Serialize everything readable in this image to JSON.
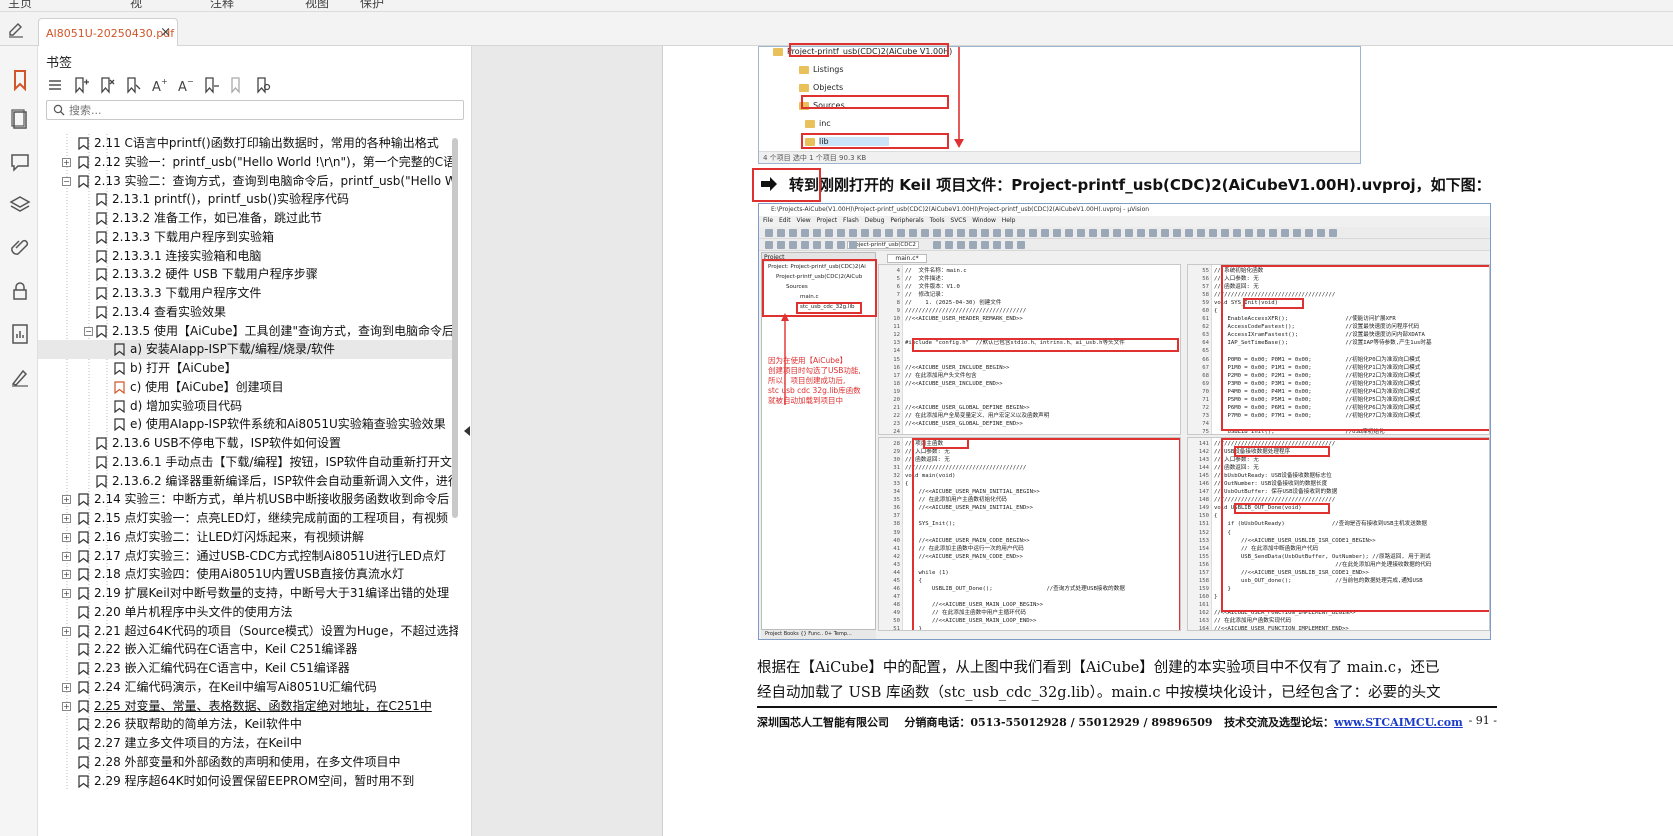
{
  "tab": {
    "title": "AI8051U-20250430.pdf",
    "close": "×"
  },
  "sidebar": {
    "title": "书签",
    "search_placeholder": "搜索...",
    "items": [
      {
        "label": "2.11  C语言中printf()函数打印输出数据时，常用的各种输出格式",
        "level": 1,
        "exp": ""
      },
      {
        "label": "2.12  实验一：printf_usb(\"Hello World !\\r\\n\")，第一个完整的C语言程",
        "level": 1,
        "exp": "+"
      },
      {
        "label": "2.13  实验二：查询方式，查询到电脑命令后，printf_usb(\"Hello Wor",
        "level": 1,
        "exp": "−"
      },
      {
        "label": "2.13.1 printf()，printf_usb()实验程序代码",
        "level": 2,
        "exp": ""
      },
      {
        "label": "2.13.2 准备工作，如已准备，跳过此节",
        "level": 2,
        "exp": ""
      },
      {
        "label": "2.13.3  下载用户程序到实验箱",
        "level": 2,
        "exp": ""
      },
      {
        "label": "2.13.3.1 连接实验箱和电脑",
        "level": 2,
        "exp": ""
      },
      {
        "label": "2.13.3.2 硬件 USB 下载用户程序步骤",
        "level": 2,
        "exp": ""
      },
      {
        "label": "2.13.3.3 下载用户程序文件",
        "level": 2,
        "exp": ""
      },
      {
        "label": "2.13.4  查看实验效果",
        "level": 2,
        "exp": ""
      },
      {
        "label": "2.13.5  使用【AiCube】工具创建\"查询方式，查询到电脑命令后,",
        "level": 2,
        "exp": "−"
      },
      {
        "label": "a) 安装AIapp-ISP下载/编程/烧录/软件",
        "level": 3,
        "exp": "",
        "sel": true
      },
      {
        "label": "b)  打开【AiCube】",
        "level": 3,
        "exp": ""
      },
      {
        "label": "c) 使用【AiCube】创建项目",
        "level": 3,
        "exp": "",
        "orange": true
      },
      {
        "label": "d) 增加实验项目代码",
        "level": 3,
        "exp": ""
      },
      {
        "label": "e) 使用AIapp-ISP软件系统和Ai8051U实验箱查验实验效果",
        "level": 3,
        "exp": ""
      },
      {
        "label": "2.13.6  USB不停电下载，ISP软件如何设置",
        "level": 2,
        "exp": ""
      },
      {
        "label": "2.13.6.1 手动点击【下载/编程】按钮，ISP软件自动重新打开文件",
        "level": 2,
        "exp": ""
      },
      {
        "label": "2.13.6.2  编译器重新编译后，ISP软件会自动重新调入文件，进行",
        "level": 2,
        "exp": ""
      },
      {
        "label": "2.14  实验三：中断方式，单片机USB中断接收服务函数收到命令后",
        "level": 1,
        "exp": "+"
      },
      {
        "label": "2.15  点灯实验一：点亮LED灯，继续完成前面的工程项目，有视频",
        "level": 1,
        "exp": "+"
      },
      {
        "label": "2.16  点灯实验二：让LED灯闪烁起来，有视频讲解",
        "level": 1,
        "exp": "+"
      },
      {
        "label": "2.17  点灯实验三：通过USB-CDC方式控制Ai8051U进行LED点灯",
        "level": 1,
        "exp": "+"
      },
      {
        "label": "2.18  点灯实验四：使用Ai8051U内置USB直接仿真流水灯",
        "level": 1,
        "exp": "+"
      },
      {
        "label": "2.19  扩展Keil对中断号数量的支持，中断号大于31编译出错的处理",
        "level": 1,
        "exp": "+"
      },
      {
        "label": "2.20  单片机程序中头文件的使用方法",
        "level": 1,
        "exp": ""
      },
      {
        "label": "2.21  超过64K代码的项目（Source模式）设置为Huge，不超过选择",
        "level": 1,
        "exp": "+"
      },
      {
        "label": "2.22  嵌入汇编代码在C语言中，Keil C251编译器",
        "level": 1,
        "exp": ""
      },
      {
        "label": "2.23  嵌入汇编代码在C语言中，Keil C51编译器",
        "level": 1,
        "exp": ""
      },
      {
        "label": "2.24  汇编代码演示，在Keil中编写Ai8051U汇编代码",
        "level": 1,
        "exp": "+"
      },
      {
        "label": "2.25  对变量、常量、表格数据、函数指定绝对地址，在C251中",
        "level": 1,
        "exp": "+",
        "u": true
      },
      {
        "label": "2.26  获取帮助的简单方法，Keil软件中",
        "level": 1,
        "exp": ""
      },
      {
        "label": "2.27  建立多文件项目的方法，在Keil中",
        "level": 1,
        "exp": ""
      },
      {
        "label": "2.28  外部变量和外部函数的声明和使用，在多文件项目中",
        "level": 1,
        "exp": ""
      },
      {
        "label": "2.29  程序超64K时如何设置保留EEPROM空间，暂时用不到",
        "level": 1,
        "exp": ""
      }
    ]
  },
  "explorer": {
    "items": [
      "Project-printf_usb(CDC)2(AiCube V1.00H)",
      "Listings",
      "Objects",
      "Sources",
      "inc",
      "lib"
    ],
    "status": "4 个项目    选中 1 个项目  90.3 KB"
  },
  "heading": "转到刚刚打开的 Keil 项目文件：Project-printf_usb(CDC)2(AiCubeV1.00H).uvproj，如下图：",
  "ide": {
    "title": "E:\\Projects-AiCube(V1.00H)\\Project-printf_usb(CDC)2(AiCubeV1.00H)\\Project-printf_usb(CDC)2(AiCubeV1.00H).uvproj - µVision",
    "menu": "File Edit View Project Flash Debug Peripherals Tools SVCS Window Help",
    "target": "Project-printf_usb(CDC2",
    "project_header": "Project",
    "project_items": [
      "Project: Project-printf_usb(CDC)2(Ai",
      "Project-printf_usb(CDC)2(AiCub",
      "Sources",
      "main.c",
      "stc_usb_cdc_32g.lib"
    ],
    "project_tabs": "Project  Books  {} Func..  0+ Temp...",
    "editor_tab": "main.c*",
    "annotation": [
      "因为在使用【AiCube】",
      "创建项目时勾选了USB功能,",
      "所以，项目创建成功后,",
      "stc usb cdc 32g.lib库函数",
      "就被自动加载到项目中"
    ],
    "pane_tl_nums": "4\n5\n6\n7\n8\n9\n10\n11\n12\n13\n14\n15\n16\n17\n18\n19\n20\n21\n22\n23\n24",
    "pane_tl_code": "//  文件名称：main.c\n//  文件描述：\n//  文件版本：V1.0\n//  修改记录：\n//    1. (2025-04-30) 创建文件\n////////////////////////////////////\n//<<AICUBE_USER_HEADER_REMARK_END>>\n\n\n#include \"config.h\"  //默认已包含stdio.h、intrins.h、ai_usb.h等头文件\n\n\n//<<AICUBE_USER_INCLUDE_BEGIN>>\n// 在此添加用户头文件包含\n//<<AICUBE_USER_INCLUDE_END>>\n\n\n//<<AICUBE_USER_GLOBAL_DEFINE_BEGIN>>\n// 在此添加用户全局变量定义、用户宏定义以及函数声明\n//<<AICUBE_USER_GLOBAL_DEFINE_END>>\n",
    "pane_tr_nums": "55\n56\n57\n58\n59\n60\n61\n62\n63\n64\n65\n66\n67\n68\n69\n70\n71\n72\n73\n74\n75",
    "pane_tr_code": "// 系统初始化函数\n// 入口参数: 无\n// 函数返回: 无\n////////////////////////////////////\nvoid SYS_Init(void)\n{\n    EnableAccessXFR();                 //使能访问扩展XFR\n    AccessCodeFastest();               //设置最快速度访问程序代码\n    AccessIXramFastest();              //设置最快速度访问内部XDATA\n    IAP_SetTimeBase();                 //设置IAP等待参数,产生1us时基\n\n    P0M0 = 0x00; P0M1 = 0x00;          //初始化P0口为准双向口模式\n    P1M0 = 0x00; P1M1 = 0x00;          //初始化P1口为准双向口模式\n    P2M0 = 0x00; P2M1 = 0x00;          //初始化P2口为准双向口模式\n    P3M0 = 0x00; P3M1 = 0x00;          //初始化P3口为准双向口模式\n    P4M0 = 0x00; P4M1 = 0x00;          //初始化P4口为准双向口模式\n    P5M0 = 0x00; P5M1 = 0x00;          //初始化P5口为准双向口模式\n    P6M0 = 0x00; P6M1 = 0x00;          //初始化P6口为准双向口模式\n    P7M0 = 0x00; P7M1 = 0x00;          //初始化P7口为准双向口模式\n\n    USBLIB_Init();                     //USB库初始化",
    "pane_bl_nums": "28\n29\n30\n31\n32\n33\n34\n35\n36\n37\n38\n39\n40\n41\n42\n43\n44\n45\n46\n47\n48\n49\n50\n51\n52",
    "pane_bl_code": "// 项目主函数\n// 入口参数: 无\n// 函数返回: 无\n////////////////////////////////////\nvoid main(void)\n{\n    //<<AICUBE_USER_MAIN_INITIAL_BEGIN>>\n    // 在此添加用户主函数初始化代码\n    //<<AICUBE_USER_MAIN_INITIAL_END>>\n\n    SYS_Init();\n\n    //<<AICUBE_USER_MAIN_CODE_BEGIN>>\n    // 在此添加主函数中运行一次的用户代码\n    //<<AICUBE_USER_MAIN_CODE_END>>\n\n    while (1)\n    {\n        USBLIB_OUT_Done();                //查询方式处理USB接收的数据\n\n        //<<AICUBE_USER_MAIN_LOOP_BEGIN>>\n        // 在此添加主函数中用户主循环代码\n        //<<AICUBE_USER_MAIN_LOOP_END>>\n    }\n}",
    "pane_br_nums": "141\n142\n143\n144\n145\n146\n147\n148\n149\n150\n151\n152\n153\n154\n155\n156\n157\n158\n159\n160\n161\n162\n163\n164\n165",
    "pane_br_code": "////////////////////////////////////\n// USB设备接收数据处理程序\n// 入口参数: 无\n// 函数返回: 无\n// bUsbOutReady: USB设备接收数据标志位\n// OutNumber: USB设备接收到的数据长度\n// UsbOutBuffer: 保存USB设备接收到的数据\n////////////////////////////////////\nvoid USBLIB_OUT_Done(void)\n{\n    if (bUsbOutReady)              //查询是否有接收到USB主机发送数据\n    {\n        //<<AICUBE_USER_USBLIB_ISR_CODE1_BEGIN>>\n        // 在此添加中断函数用户代码\n        USB_SendData(UsbOutBuffer, OutNumber); //原路返回, 用于测试\n                                    //在此处添加用户处理接收数据的代码\n        //<<AICUBE_USER_USBLIB_ISR_CODE1_END>>\n        usb_OUT_done();             //当前包的数据处理完成,通知USB\n    }\n}\n\n//<<AICUBE_USER_FUNCTION_IMPLEMENT_BEGIN>>\n// 在此添加用户函数实现代码\n//<<AICUBE_USER_FUNCTION_IMPLEMENT_END>>\n"
  },
  "body": {
    "line1": "根据在【AiCube】中的配置，从上图中我们看到【AiCube】创建的本实验项目中不仅有了 main.c，还已",
    "line2": "经自动加载了 USB 库函数（stc_usb_cdc_32g.lib）。main.c 中按模块化设计，已经包含了：必要的头文"
  },
  "footer": {
    "company": "深圳国芯人工智能有限公司",
    "phone": "分销商电话：0513-55012928 / 55012929 / 89896509",
    "forum": "技术交流及选型论坛：",
    "link": "www.STCAIMCU.com",
    "page": "- 91 -"
  },
  "colors": {
    "accent": "#d2552a",
    "red": "#e03131",
    "link": "#1a3cc8"
  }
}
